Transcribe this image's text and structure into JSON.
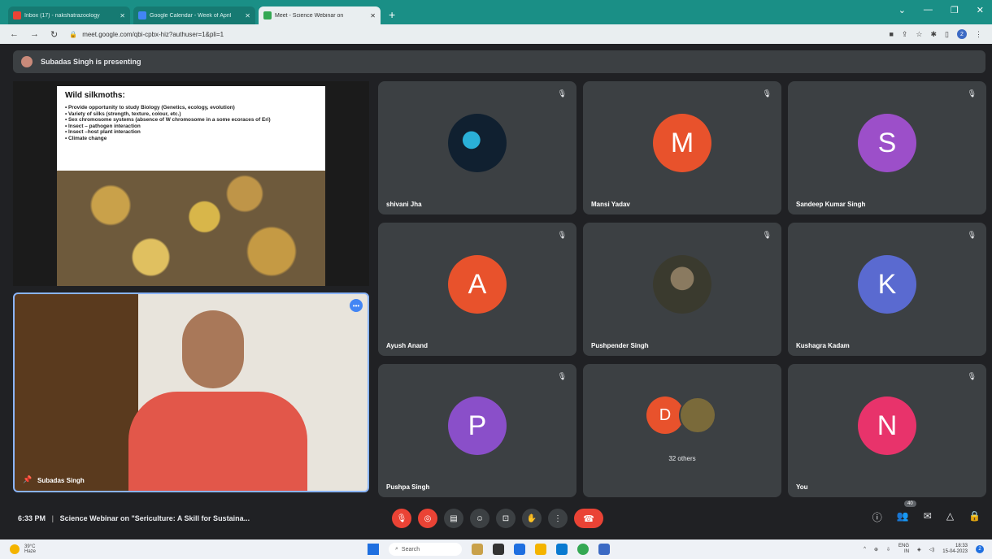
{
  "browser": {
    "tabs": [
      {
        "label": "Inbox (17) - nakshatrazoology",
        "fav_color": "#ea4335"
      },
      {
        "label": "Google Calendar - Week of April",
        "fav_color": "#4285f4"
      },
      {
        "label": "Meet - Science Webinar on",
        "fav_color": "#34a853"
      }
    ],
    "new_tab": "+",
    "url": "meet.google.com/qbi-cpbx-hiz?authuser=1&pli=1",
    "profile_initial": "2"
  },
  "presenting_banner": "Subadas Singh is presenting",
  "slide": {
    "title": "Wild silkmoths:",
    "bullets": [
      "Provide opportunity to study Biology (Genetics, ecology, evolution)",
      "Variety of silks (strength, texture, colour, etc.)",
      "Sex chromosome systems (absence of W chromosome in a some ecoraces of Eri)",
      "Insect – pathogen interaction",
      "Insect –host plant interaction",
      "Climate change"
    ]
  },
  "self_view": {
    "name": "Subadas Singh",
    "more_label": "•••"
  },
  "participants": [
    {
      "name": "shivani Jha",
      "initial": "",
      "color": "#111111"
    },
    {
      "name": "Mansi Yadav",
      "initial": "M",
      "color": "#e8522c"
    },
    {
      "name": "Sandeep Kumar Singh",
      "initial": "S",
      "color": "#9c4fc9"
    },
    {
      "name": "Ayush Anand",
      "initial": "A",
      "color": "#e8522c"
    },
    {
      "name": "Pushpender Singh",
      "initial": "",
      "color": "#6b5a48"
    },
    {
      "name": "Kushagra Kadam",
      "initial": "K",
      "color": "#5a6ad0"
    },
    {
      "name": "Pushpa Singh",
      "initial": "P",
      "color": "#8a4fc9"
    },
    {
      "name": "You",
      "initial": "N",
      "color": "#e8336b"
    }
  ],
  "others_tile": {
    "initial": "D",
    "label": "32 others"
  },
  "bottom": {
    "time": "6:33 PM",
    "meeting_title": "Science Webinar on \"Sericulture: A Skill for Sustaina...",
    "people_count": "40"
  },
  "taskbar": {
    "temperature": "39°C",
    "condition": "Haze",
    "search_placeholder": "Search",
    "lang": "ENG",
    "region": "IN",
    "time": "18:33",
    "date": "15-04-2023",
    "notification_count": "2"
  }
}
